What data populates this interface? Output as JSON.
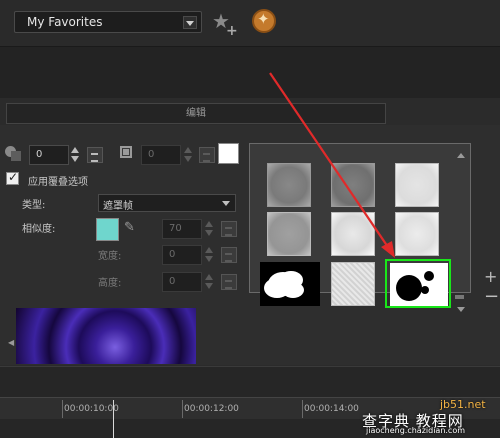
{
  "header": {
    "favorites_dropdown": "My Favorites",
    "add_favorite_icon": "star-plus-icon",
    "fx_icon": "fx-library-icon"
  },
  "tab": {
    "label": "编辑"
  },
  "overlay": {
    "opacity_value": "0",
    "border_value": "0",
    "border_color": "#ffffff",
    "apply_overlay_label": "应用覆叠选项",
    "apply_overlay_checked": true,
    "type_label": "类型:",
    "type_value": "遮罩帧",
    "similarity_label": "相似度:",
    "similarity_value": "70",
    "similarity_color": "#6fd6cd",
    "width_label": "宽度:",
    "width_value": "0",
    "height_label": "高度:",
    "height_value": "0"
  },
  "mask_frames": {
    "items": [
      "gray-frame",
      "gray-frame-2",
      "light-frame",
      "gray-frame-3",
      "light-texture",
      "light-texture-2",
      "cloud-mask",
      "grain-mask",
      "dots-mask"
    ],
    "selected_index": 8,
    "selection_color": "#19e619"
  },
  "timeline": {
    "ticks": [
      "00:00:10:00",
      "00:00:12:00",
      "00:00:14:00"
    ]
  },
  "watermark": {
    "site": "jb51.net",
    "title": "查字典 教程网",
    "url": "jiaocheng.chazidian.com"
  },
  "annotation": {
    "arrow_color": "#e02a2a"
  }
}
